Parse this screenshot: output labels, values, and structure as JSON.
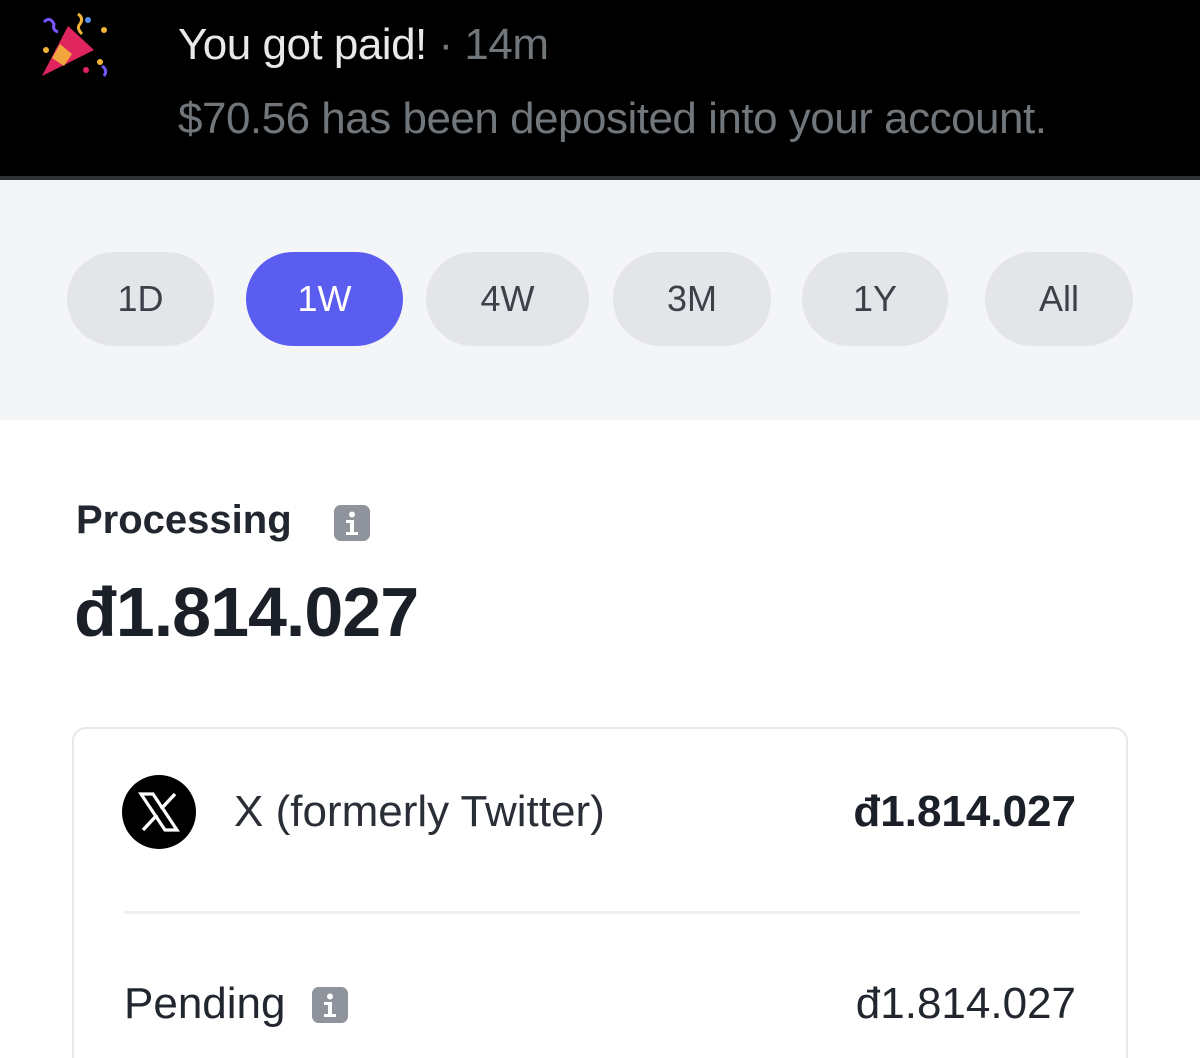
{
  "notification": {
    "icon": "party-popper-icon",
    "title": "You got paid!",
    "separator": "·",
    "time": "14m",
    "body": "$70.56 has been deposited into your account."
  },
  "range": {
    "options": [
      "1D",
      "1W",
      "4W",
      "3M",
      "1Y",
      "All"
    ],
    "selected": "1W",
    "accent_color": "#5b5cf0"
  },
  "processing": {
    "label": "Processing",
    "amount": "đ1.814.027"
  },
  "breakdown": {
    "source": {
      "name": "X (formerly Twitter)",
      "amount": "đ1.814.027",
      "icon": "x-logo-icon"
    },
    "pending": {
      "label": "Pending",
      "amount": "đ1.814.027"
    }
  }
}
